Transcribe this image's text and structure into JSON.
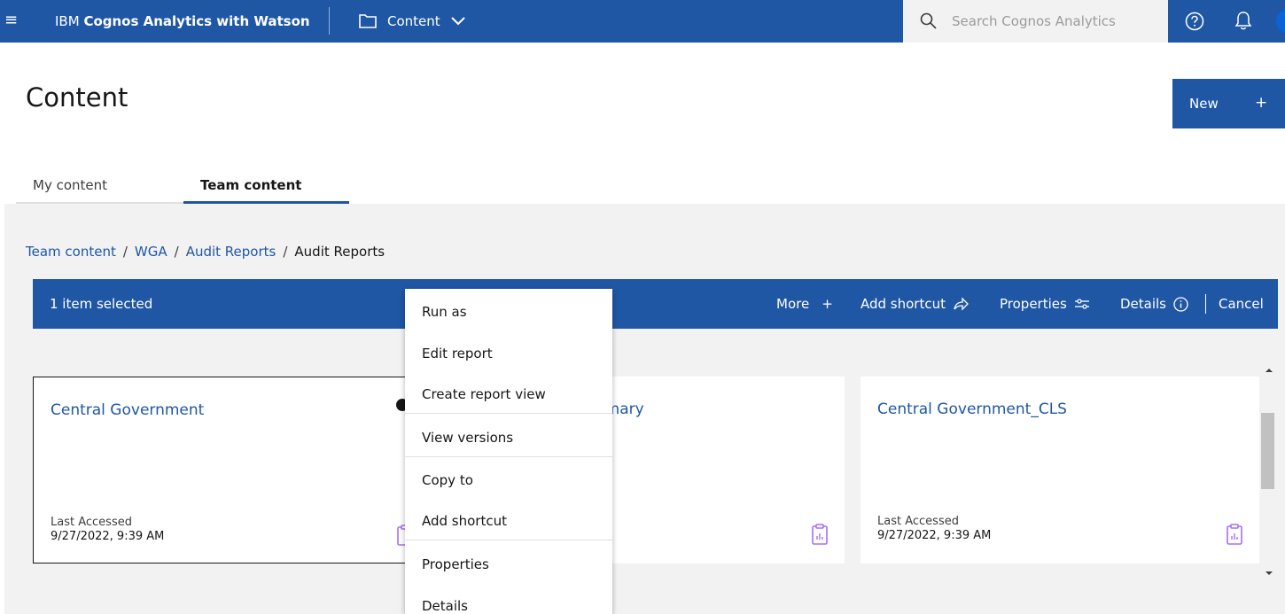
{
  "topbar": {
    "brand_prefix": "IBM ",
    "brand_name": "Cognos Analytics with Watson",
    "content_label": "Content",
    "search_placeholder": "Search Cognos Analytics"
  },
  "page": {
    "title": "Content",
    "new_label": "New",
    "new_plus": "+"
  },
  "tabs": [
    {
      "label": "My content"
    },
    {
      "label": "Team content"
    }
  ],
  "breadcrumb": {
    "items": [
      "Team content",
      "WGA",
      "Audit Reports"
    ],
    "current": "Audit Reports",
    "separator": "/"
  },
  "selection_bar": {
    "count_label": "1 item selected",
    "more_label": "More",
    "more_plus": "+",
    "add_shortcut_label": "Add shortcut",
    "properties_label": "Properties",
    "details_label": "Details",
    "cancel_label": "Cancel"
  },
  "cards": [
    {
      "title": "Central Government",
      "meta_label": "Last Accessed",
      "meta_date": "9/27/2022, 9:39 AM"
    },
    {
      "title": "Primary",
      "meta_label": "",
      "meta_date": ""
    },
    {
      "title": "Central Government_CLS",
      "meta_label": "Last Accessed",
      "meta_date": "9/27/2022, 9:39 AM"
    }
  ],
  "context_menu": {
    "items": [
      "Run as",
      "Edit report",
      "Create report view",
      "View versions",
      "Copy to",
      "Add shortcut",
      "Properties",
      "Details"
    ]
  },
  "colors": {
    "brand_blue": "#1f57a5",
    "content_bg": "#f2f2f2",
    "report_icon": "#a56eff"
  }
}
